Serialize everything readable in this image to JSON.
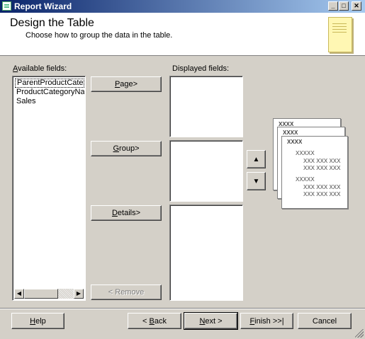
{
  "window": {
    "title": "Report Wizard"
  },
  "header": {
    "title": "Design the Table",
    "subtitle": "Choose how to group the data in the table."
  },
  "available_fields": {
    "label_accel": "A",
    "label_rest": "vailable fields:",
    "items": [
      "ParentProductCategoryName",
      "ProductCategoryName",
      "Sales"
    ]
  },
  "displayed_fields": {
    "label": "Displayed fields:"
  },
  "buttons": {
    "page": {
      "accel": "P",
      "rest": "age>"
    },
    "group": {
      "accel": "G",
      "rest": "roup>"
    },
    "details": {
      "accel": "D",
      "rest": "etails>"
    },
    "remove": "< Remove",
    "move_up": "▲",
    "move_down": "▼"
  },
  "preview": {
    "page1": "XXXX",
    "page2": "XXXX",
    "page3": "XXXX",
    "detail_header": "XXXXX",
    "rows": [
      "XXX XXX XXX",
      "XXX XXX XXX",
      "XXXXX",
      "XXX XXX XXX",
      "XXX XXX XXX"
    ]
  },
  "footer": {
    "help": {
      "accel": "H",
      "rest": "elp"
    },
    "back": {
      "pre": "< ",
      "accel": "B",
      "rest": "ack"
    },
    "next": {
      "accel": "N",
      "rest": "ext >"
    },
    "finish": {
      "accel": "F",
      "rest": "inish >>|"
    },
    "cancel": "Cancel"
  },
  "colors": {
    "titlebar_start": "#0a246a",
    "titlebar_end": "#a6caf0",
    "dialog_bg": "#d4d0c8"
  }
}
